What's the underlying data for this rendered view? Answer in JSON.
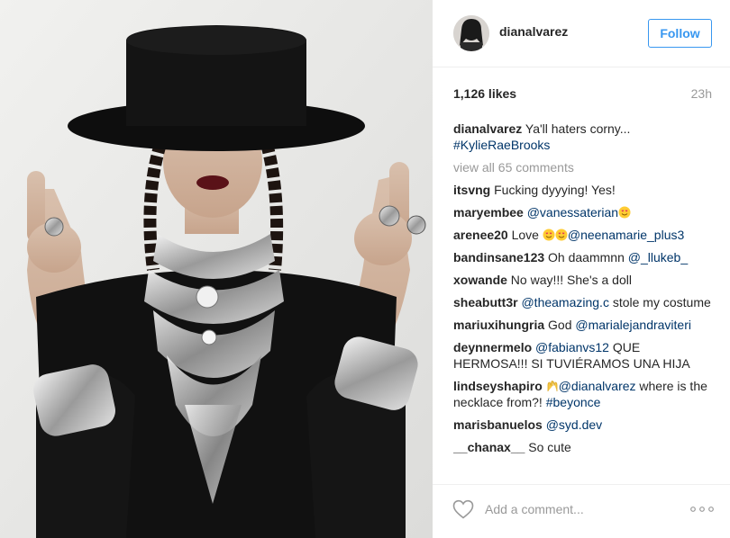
{
  "post": {
    "username": "dianalvarez",
    "follow_label": "Follow",
    "likes": "1,126 likes",
    "time": "23h",
    "caption_user": "dianalvarez",
    "caption_text": "Ya'll haters corny...",
    "caption_hashtag": "#KylieRaeBrooks",
    "view_all": "view all 65 comments"
  },
  "comments": [
    {
      "user": "itsvng",
      "parts": [
        {
          "t": "Fucking dyyying! Yes!"
        }
      ]
    },
    {
      "user": "maryembee",
      "parts": [
        {
          "t": "@vanessaterian",
          "mention": true
        },
        {
          "emoji": "smile-hearts"
        }
      ]
    },
    {
      "user": "arenee20",
      "parts": [
        {
          "t": "Love "
        },
        {
          "emoji": "smile-hearts"
        },
        {
          "emoji": "smile-hearts"
        },
        {
          "t": "@neenamarie_plus3",
          "mention": true
        }
      ]
    },
    {
      "user": "bandinsane123",
      "parts": [
        {
          "t": "Oh daammnn "
        },
        {
          "t": "@_llukeb_",
          "mention": true
        }
      ]
    },
    {
      "user": "xowande",
      "parts": [
        {
          "t": "No way!!! She's a doll"
        }
      ]
    },
    {
      "user": "sheabutt3r",
      "parts": [
        {
          "t": "@theamazing.c",
          "mention": true
        },
        {
          "t": " stole my costume"
        }
      ]
    },
    {
      "user": "mariuxihungria",
      "parts": [
        {
          "t": "God "
        },
        {
          "t": "@marialejandraviteri",
          "mention": true
        }
      ]
    },
    {
      "user": "deynnermelo",
      "parts": [
        {
          "t": "@fabianvs12",
          "mention": true
        },
        {
          "t": " QUE HERMOSA!!! SI TUVIÉRAMOS UNA HIJA"
        }
      ]
    },
    {
      "user": "lindseyshapiro",
      "parts": [
        {
          "emoji": "raised-hands"
        },
        {
          "t": "@dianalvarez",
          "mention": true
        },
        {
          "t": " where is the necklace from?! "
        },
        {
          "t": "#beyonce",
          "mention": true
        }
      ]
    },
    {
      "user": "marisbanuelos",
      "parts": [
        {
          "t": "@syd.dev",
          "mention": true
        }
      ]
    },
    {
      "user": "__chanax__",
      "parts": [
        {
          "t": "So cute"
        }
      ]
    }
  ],
  "footer": {
    "placeholder": "Add a comment...",
    "heart_icon": "heart-icon",
    "more_icon": "more-options-icon"
  },
  "colors": {
    "link": "#003569",
    "follow": "#3897f0",
    "muted": "#999999"
  }
}
